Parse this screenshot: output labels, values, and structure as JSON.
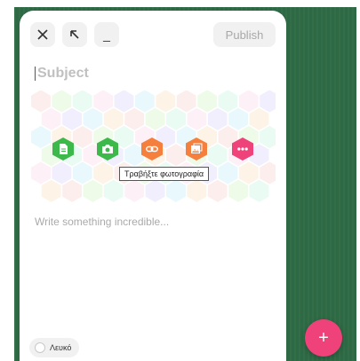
{
  "header": {
    "close_icon": "close-icon",
    "expand_icon": "arrow-up-left-icon",
    "minimize_label": "_",
    "publish_label": "Publish"
  },
  "editor": {
    "subject_placeholder": "Subject",
    "content_placeholder": "Write something incredible..."
  },
  "toolbar": {
    "items": [
      {
        "icon": "document-icon",
        "color": "#3cb94a"
      },
      {
        "icon": "camera-icon",
        "color": "#3cb94a"
      },
      {
        "icon": "link-icon",
        "color": "#f57f3c"
      },
      {
        "icon": "image-icon",
        "color": "#f57f3c"
      },
      {
        "icon": "more-icon",
        "color": "#f0427a"
      }
    ],
    "tooltip": "Τραβήξτε φωτογραφία"
  },
  "theme_selector": {
    "label": "Λευκό"
  },
  "fab": {
    "label": "+",
    "color": "#f0427a"
  }
}
